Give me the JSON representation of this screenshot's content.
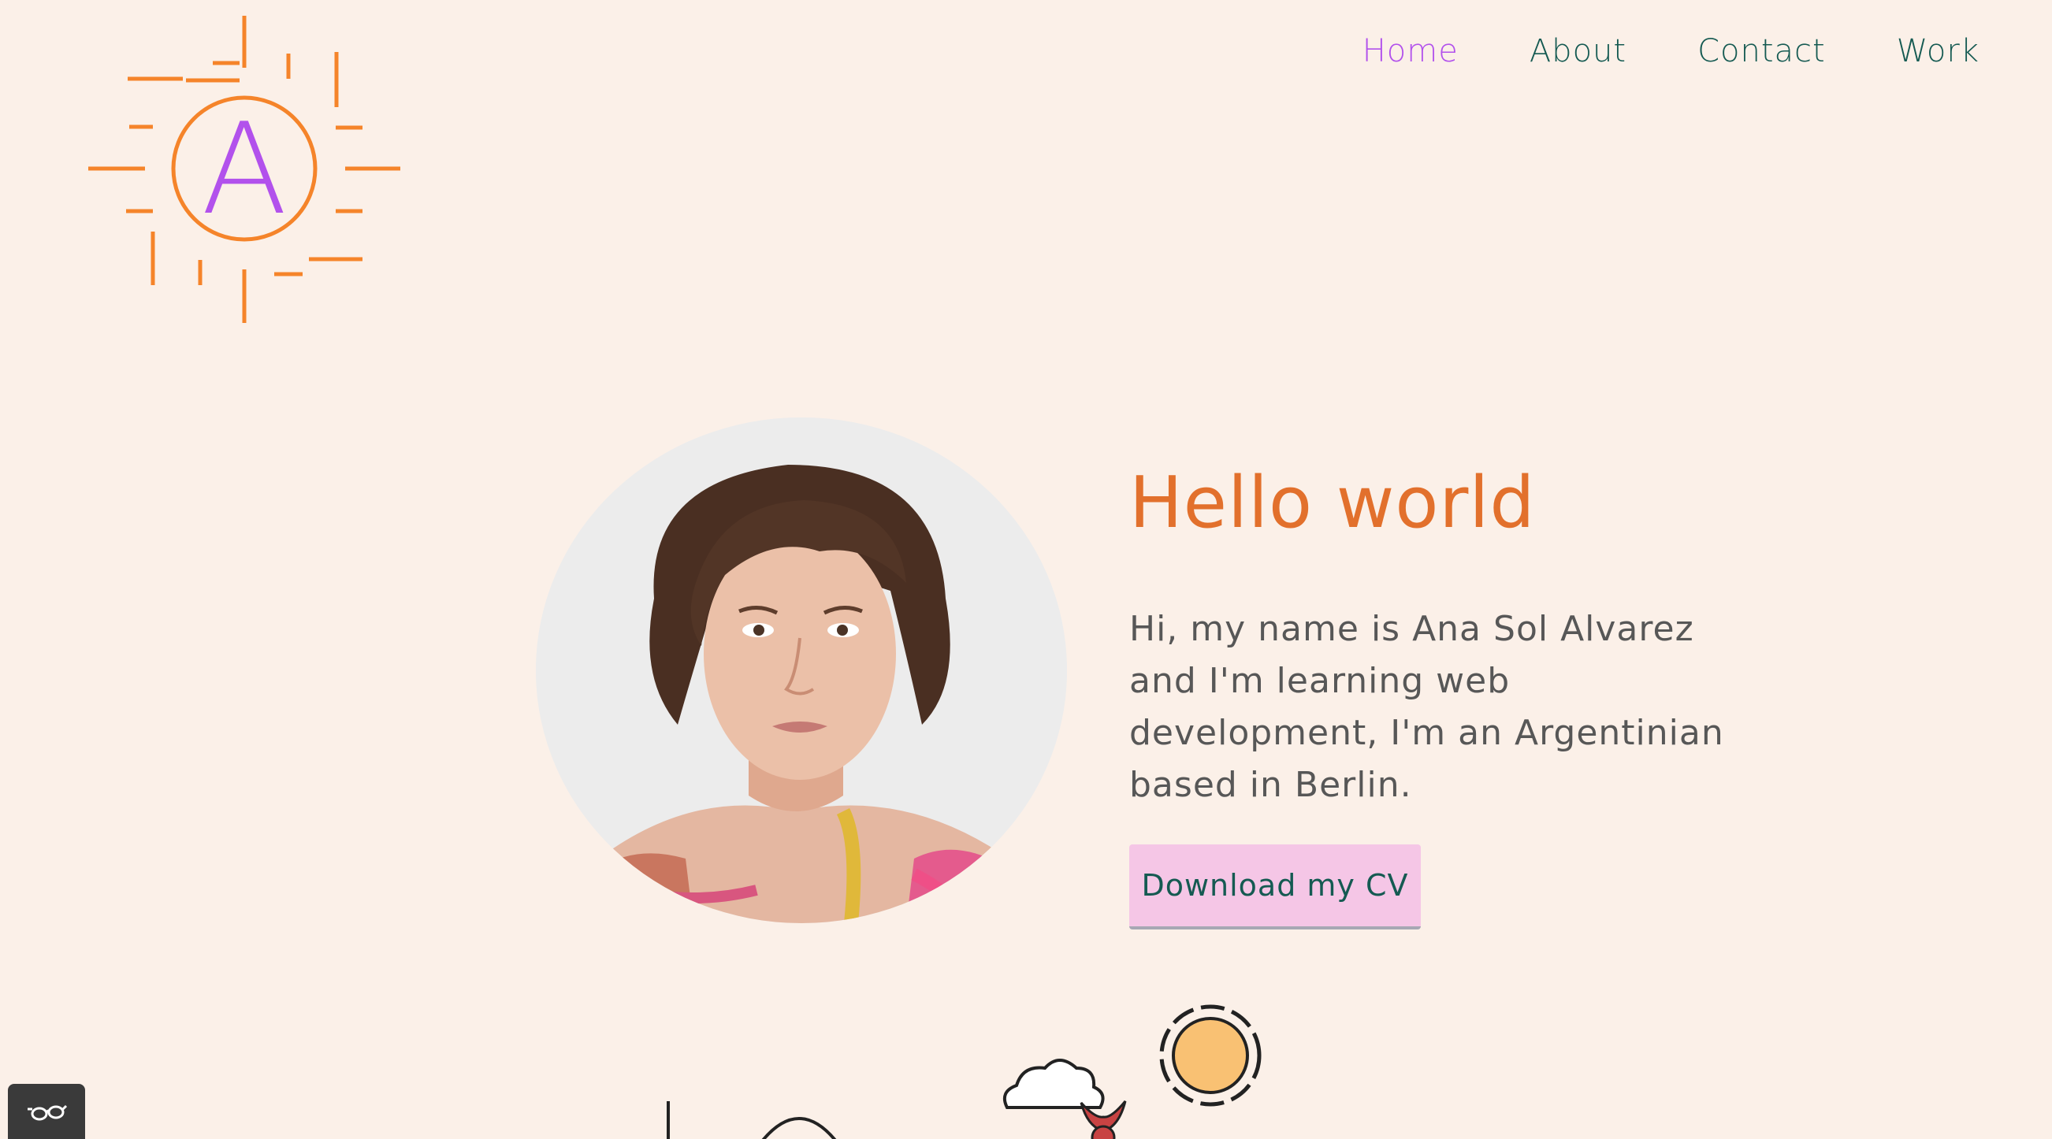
{
  "logo": {
    "letter": "A",
    "icon": "sun-logo-icon",
    "ray_color": "#f5842a",
    "letter_color": "#b251ec"
  },
  "nav": {
    "items": [
      {
        "label": "Home",
        "active": true
      },
      {
        "label": "About",
        "active": false
      },
      {
        "label": "Contact",
        "active": false
      },
      {
        "label": "Work",
        "active": false
      }
    ],
    "active_color": "#b251ec",
    "color": "#155a52"
  },
  "hero": {
    "title": "Hello world",
    "intro": "Hi, my name is Ana Sol Alvarez and I'm learning web development, I'm an Argentinian based in Berlin.",
    "cv_button": "Download my CV",
    "photo_icon": "profile-photo"
  },
  "illustration": {
    "icons": [
      "sun-icon",
      "cloud-icon",
      "bird-icon"
    ]
  },
  "accessibility": {
    "icon": "glasses-icon"
  },
  "colors": {
    "background": "#fbf0e8",
    "title": "#e2702c",
    "text": "#575757",
    "button": "#f5c6e6"
  }
}
